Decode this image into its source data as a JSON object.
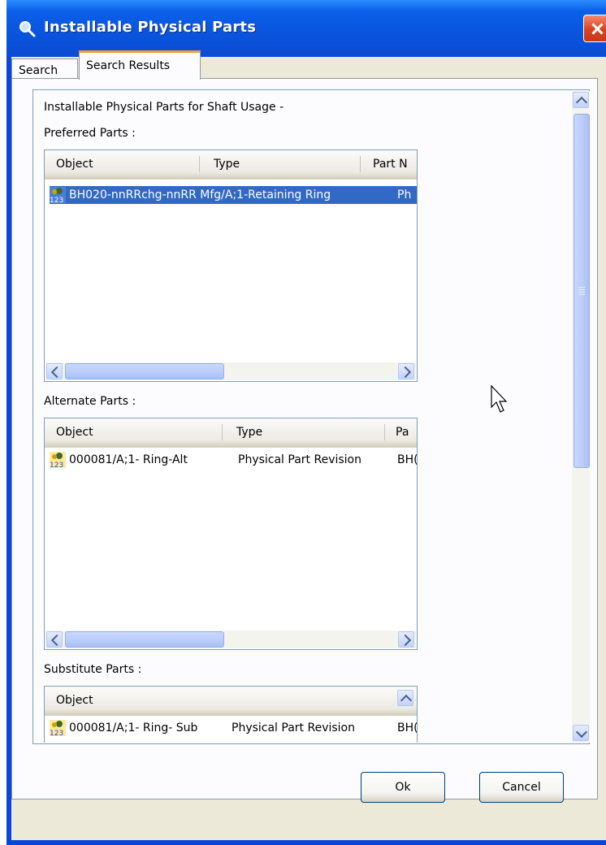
{
  "window": {
    "title": "Installable Physical Parts"
  },
  "tabs": [
    {
      "label": "Search"
    },
    {
      "label": "Search Results"
    }
  ],
  "content": {
    "heading": "Installable Physical Parts for Shaft Usage -",
    "preferred": {
      "label": "Preferred Parts :",
      "columns": [
        "Object",
        "Type",
        "Part N"
      ],
      "rows": [
        {
          "object": "BH020-nnRRchg-nnRR Mfg/A;1-Retaining Ring",
          "trail": "Ph",
          "selected": true
        }
      ]
    },
    "alternate": {
      "label": "Alternate Parts :",
      "columns": [
        "Object",
        "Type",
        "Pa"
      ],
      "rows": [
        {
          "object": "000081/A;1- Ring-Alt",
          "type": "Physical Part Revision",
          "trail": "BH("
        }
      ]
    },
    "substitute": {
      "label": "Substitute Parts :",
      "columns": [
        "Object"
      ],
      "rows": [
        {
          "object": "000081/A;1- Ring- Sub",
          "type": "Physical Part Revision",
          "trail": "BH("
        }
      ]
    }
  },
  "buttons": {
    "ok": "Ok",
    "cancel": "Cancel"
  },
  "icons": {
    "title": "magnifier-icon",
    "part": "physical-part-icon",
    "close": "close-icon"
  },
  "colors": {
    "titlebar": "#0a54dd",
    "selection": "#316ac5",
    "tab_accent": "#f0a030"
  }
}
